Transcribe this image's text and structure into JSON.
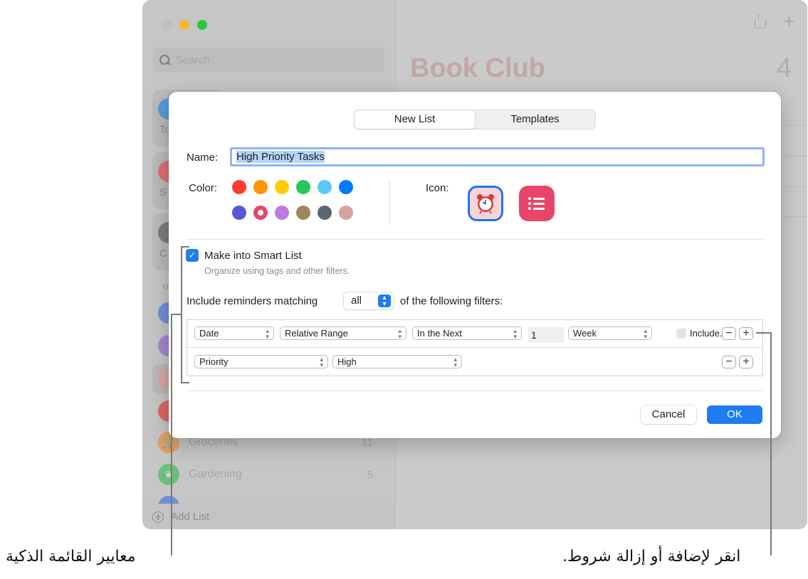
{
  "window": {
    "search_placeholder": "Search",
    "smart_tiles": [
      {
        "label": "To",
        "color": "#5a9ae0"
      },
      {
        "label": "S",
        "color": "#e07070"
      },
      {
        "label": "C",
        "color": "#7d7d7d"
      }
    ],
    "section_label": "M",
    "lists": [
      {
        "name": "",
        "count": "",
        "color": "#6d8fdb"
      },
      {
        "name": "",
        "count": "",
        "color": "#a887cf"
      },
      {
        "name": "",
        "count": "",
        "color": "#d8a8a3"
      },
      {
        "name": "",
        "count": "",
        "color": "#db6a62"
      },
      {
        "name": "Groceries",
        "count": "11",
        "color": "#e0a060"
      },
      {
        "name": "Gardening",
        "count": "5",
        "color": "#6bbf79"
      }
    ],
    "add_list_label": "Add List",
    "content_title": "Book Club",
    "content_count": "4"
  },
  "dialog": {
    "tabs": [
      {
        "label": "New List",
        "active": true
      },
      {
        "label": "Templates",
        "active": false
      }
    ],
    "name_label": "Name:",
    "name_value": "High Priority Tasks",
    "color_label": "Color:",
    "colors": [
      "#ff3b30",
      "#ff9500",
      "#ffcc00",
      "#28c759",
      "#5ac8fa",
      "#007aff",
      "#5856d6",
      "#e8456a",
      "#bf7ade",
      "#a2845e",
      "#5b6770",
      "#d8a39d"
    ],
    "selected_color": "#e8456a",
    "icon_label": "Icon:",
    "icons": [
      {
        "name": "alarm-clock",
        "selected": true
      },
      {
        "name": "list",
        "selected": false
      }
    ],
    "smart_list_checkbox": {
      "label": "Make into Smart List",
      "checked": true
    },
    "smart_list_subtext": "Organize using tags and other filters.",
    "match_prefix": "Include reminders matching",
    "match_value": "all",
    "match_suffix": "of the following filters:",
    "filters": [
      {
        "field": "Date",
        "operator": "Relative Range",
        "qualifier": "In the Next",
        "amount": "1",
        "unit": "Week",
        "include_label": "Include...",
        "include_checked": false
      },
      {
        "field": "Priority",
        "value": "High"
      }
    ],
    "remove_label": "−",
    "add_label": "+",
    "cancel_label": "Cancel",
    "ok_label": "OK"
  },
  "callouts": {
    "smart_list_criteria": "معايير القائمة الذكية",
    "add_remove_conditions": "انقر لإضافة أو إزالة شروط."
  }
}
